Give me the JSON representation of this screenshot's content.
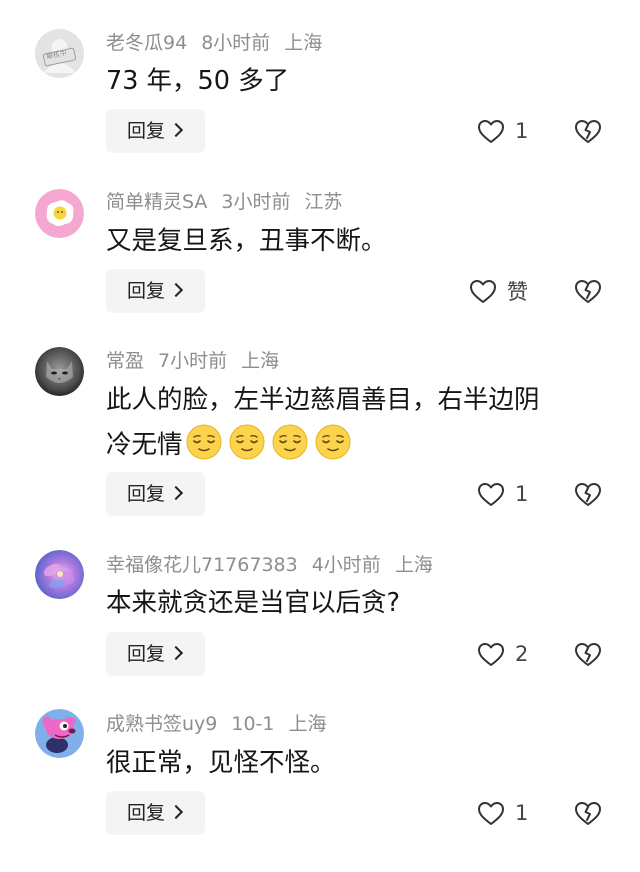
{
  "comments": [
    {
      "username": "老冬瓜94",
      "time": "8小时前",
      "location": "上海",
      "text": "73 年，50 多了",
      "avatar_badge": "审核中",
      "reply_label": "回复",
      "likes": "1"
    },
    {
      "username": "简单精灵SA",
      "time": "3小时前",
      "location": "江苏",
      "text": "又是复旦系，丑事不断。",
      "reply_label": "回复",
      "likes": "赞"
    },
    {
      "username": "常盈",
      "time": "7小时前",
      "location": "上海",
      "text_line1": "此人的脸，左半边慈眉善目，右半边阴",
      "text_line2": "冷无情",
      "emojis": [
        "relieved-face-icon",
        "relieved-face-icon",
        "relieved-face-icon",
        "relieved-face-icon"
      ],
      "reply_label": "回复",
      "likes": "1"
    },
    {
      "username": "幸福像花儿71767383",
      "time": "4小时前",
      "location": "上海",
      "text": "本来就贪还是当官以后贪?",
      "reply_label": "回复",
      "likes": "2"
    },
    {
      "username": "成熟书签uy9",
      "time": "10-1",
      "location": "上海",
      "text": "很正常，见怪不怪。",
      "reply_label": "回复",
      "likes": "1"
    }
  ],
  "colors": {
    "meta": "#8e8e8e",
    "text": "#161616",
    "button_bg": "#f4f4f4"
  }
}
